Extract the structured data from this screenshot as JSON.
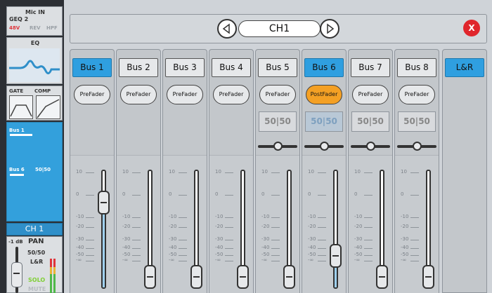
{
  "sidebar": {
    "input_label": "Mic IN",
    "geq_label": "GEQ 2",
    "phantom_label": "48V",
    "rev_label": "REV",
    "hpf_label": "HPF",
    "eq_label": "EQ",
    "gate_label": "GATE",
    "comp_label": "COMP",
    "bus_sends": [
      {
        "label": "Bus 1",
        "value": ""
      },
      {
        "label": "Bus 6",
        "value": "50|50"
      }
    ],
    "channel_name": "CH 1",
    "gain_label": "-1 dB",
    "pan_label": "PAN",
    "pan_value": "50/50",
    "output_label": "L&R",
    "solo_label": "SOLO",
    "mute_label": "MUTE"
  },
  "header": {
    "channel_name": "CH1",
    "close_label": "X"
  },
  "scale_labels": [
    "10",
    "0",
    "-10",
    "-20",
    "-30",
    "-40",
    "-50",
    "-∞"
  ],
  "buses": [
    {
      "label": "Bus 1",
      "active": true,
      "tap": "PreFader",
      "tap_active": false,
      "pan": "",
      "fader_level": 0.78
    },
    {
      "label": "Bus 2",
      "active": false,
      "tap": "PreFader",
      "tap_active": false,
      "pan": "",
      "fader_level": 0.0
    },
    {
      "label": "Bus 3",
      "active": false,
      "tap": "PreFader",
      "tap_active": false,
      "pan": "",
      "fader_level": 0.0
    },
    {
      "label": "Bus 4",
      "active": false,
      "tap": "PreFader",
      "tap_active": false,
      "pan": "",
      "fader_level": 0.0
    },
    {
      "label": "Bus 5",
      "active": false,
      "tap": "PreFader",
      "tap_active": false,
      "pan": "50|50",
      "fader_level": 0.0
    },
    {
      "label": "Bus 6",
      "active": true,
      "tap": "PostFader",
      "tap_active": true,
      "pan": "50|50",
      "fader_level": 0.22
    },
    {
      "label": "Bus 7",
      "active": false,
      "tap": "PreFader",
      "tap_active": false,
      "pan": "50|50",
      "fader_level": 0.0
    },
    {
      "label": "Bus 8",
      "active": false,
      "tap": "PreFader",
      "tap_active": false,
      "pan": "50|50",
      "fader_level": 0.0
    }
  ],
  "main_bus": {
    "label": "L&R"
  },
  "colors": {
    "active_blue": "#2f9fe0",
    "postfader_orange": "#f4a024",
    "close_red": "#e0262c",
    "solo_green": "#7fcf34",
    "phantom_red": "#e0343a"
  }
}
